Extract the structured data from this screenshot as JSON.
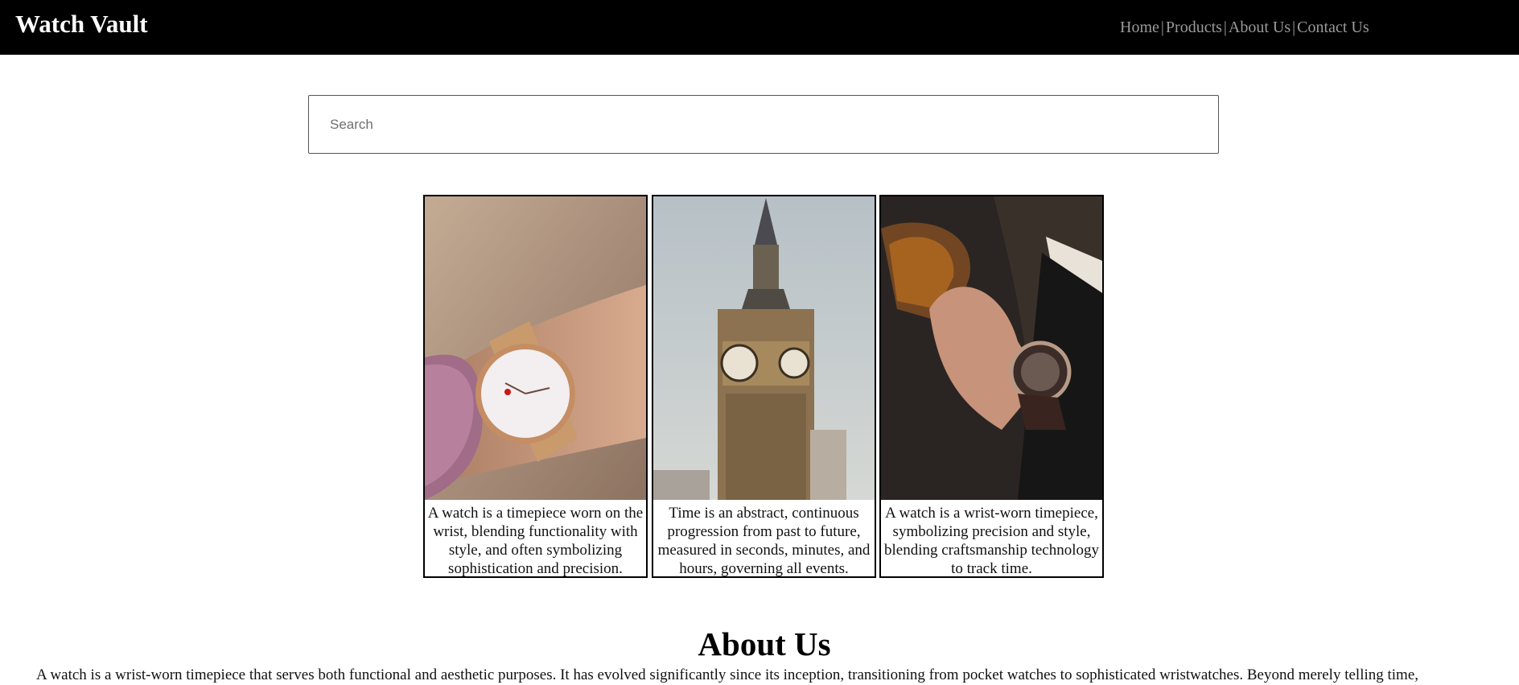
{
  "brand": {
    "title": "Watch Vault"
  },
  "nav": {
    "items": [
      "Home",
      "Products",
      "About Us",
      "Contact Us"
    ],
    "separator": "|"
  },
  "search": {
    "placeholder": "Search",
    "value": ""
  },
  "cards": [
    {
      "image": "wrist-watch-rose-gold-photo",
      "caption": "A watch is a timepiece worn on the wrist, blending functionality with style, and often symbolizing sophistication and precision."
    },
    {
      "image": "big-ben-clock-tower-photo",
      "caption": "Time is an abstract, continuous progression from past to future, measured in seconds, minutes, and hours, governing all events."
    },
    {
      "image": "man-drinking-with-watch-photo",
      "caption": "A watch is a wrist-worn timepiece, symbolizing precision and style, blending craftsmanship technology to track time."
    }
  ],
  "about": {
    "title": "About Us",
    "text": "A watch is a wrist-worn timepiece that serves both functional and aesthetic purposes. It has evolved significantly since its inception, transitioning from pocket watches to sophisticated wristwatches. Beyond merely telling time,"
  },
  "colors": {
    "header_bg": "#000000",
    "nav_text": "#9a9a9a",
    "card_border": "#000000"
  }
}
